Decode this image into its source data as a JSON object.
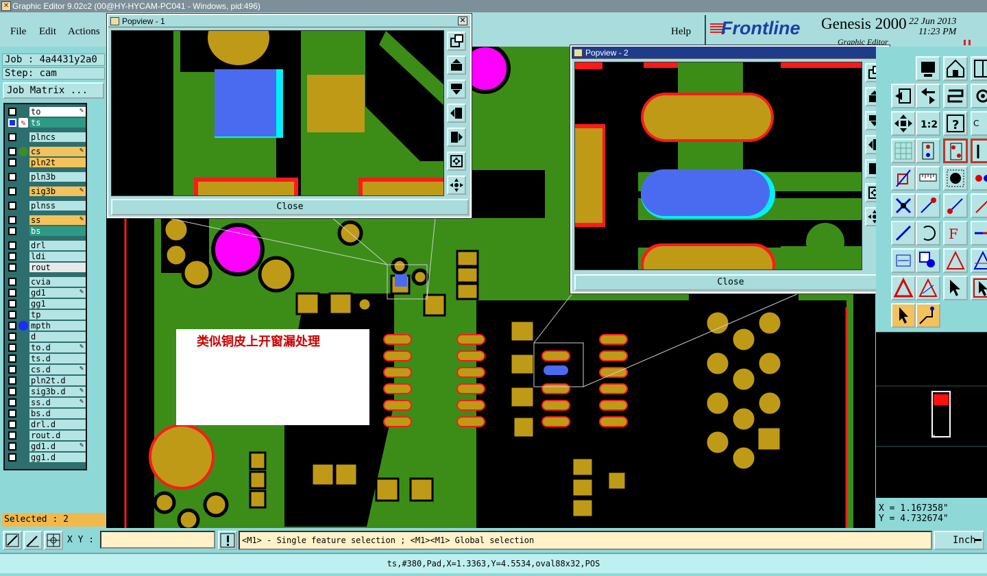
{
  "window": {
    "title": "Graphic Editor 9.02c2 (00@HY-HYCAM-PC041 - Windows, pid:496)"
  },
  "menu": {
    "file": "File",
    "edit": "Edit",
    "actions": "Actions",
    "help": "Help"
  },
  "brand": {
    "logo": "Frontline",
    "product": "Genesis 2000",
    "date": "22 Jun 2013",
    "time": "11:23 PM",
    "subtitle": "Graphic Editor"
  },
  "job": {
    "label": "Job : 4a4431y2a0",
    "step": "Step: cam",
    "matrix_button": "Job Matrix ..."
  },
  "layers": [
    {
      "name": "to",
      "color": "#ffffff",
      "editable": true
    },
    {
      "name": "ts",
      "color": "#2d9a86",
      "editable": false,
      "work": true
    },
    {
      "name": "plncs",
      "color": "#b4e4e4",
      "editable": false
    },
    {
      "name": "cs",
      "color": "#f3c25a",
      "editable": true,
      "dot": "#3a8d2a"
    },
    {
      "name": "pln2t",
      "color": "#f3c25a",
      "editable": false
    },
    {
      "name": "pln3b",
      "color": "#b4e4e4",
      "editable": false
    },
    {
      "name": "sig3b",
      "color": "#f3c25a",
      "editable": true
    },
    {
      "name": "plnss",
      "color": "#b4e4e4",
      "editable": false
    },
    {
      "name": "ss",
      "color": "#f3c25a",
      "editable": true
    },
    {
      "name": "bs",
      "color": "#2d9a86",
      "editable": false
    },
    {
      "name": "drl",
      "color": "#b4e4e4",
      "editable": false
    },
    {
      "name": "ldi",
      "color": "#b4e4e4",
      "editable": false
    },
    {
      "name": "rout",
      "color": "#e8e8e8",
      "editable": false
    },
    {
      "name": "cvia",
      "color": "#b4e4e4",
      "editable": false
    },
    {
      "name": "gd1",
      "color": "#b4e4e4",
      "editable": true
    },
    {
      "name": "gg1",
      "color": "#b4e4e4",
      "editable": false
    },
    {
      "name": "tp",
      "color": "#b4e4e4",
      "editable": false
    },
    {
      "name": "mpth",
      "color": "#b4e4e4",
      "editable": false,
      "dot": "#1b2cff"
    },
    {
      "name": "d",
      "color": "#b4e4e4",
      "editable": false
    },
    {
      "name": "to.d",
      "color": "#b4e4e4",
      "editable": true
    },
    {
      "name": "ts.d",
      "color": "#b4e4e4",
      "editable": false
    },
    {
      "name": "cs.d",
      "color": "#b4e4e4",
      "editable": true
    },
    {
      "name": "pln2t.d",
      "color": "#b4e4e4",
      "editable": false
    },
    {
      "name": "sig3b.d",
      "color": "#b4e4e4",
      "editable": true
    },
    {
      "name": "ss.d",
      "color": "#b4e4e4",
      "editable": true
    },
    {
      "name": "bs.d",
      "color": "#b4e4e4",
      "editable": false
    },
    {
      "name": "drl.d",
      "color": "#b4e4e4",
      "editable": false
    },
    {
      "name": "rout.d",
      "color": "#b4e4e4",
      "editable": false
    },
    {
      "name": "gd1.d",
      "color": "#b4e4e4",
      "editable": true
    },
    {
      "name": "gg1.d",
      "color": "#b4e4e4",
      "editable": false
    }
  ],
  "selection": {
    "label": "Selected : 2"
  },
  "annotation": {
    "text": "类似铜皮上开窗漏处理"
  },
  "popview1": {
    "title": "Popview - 1",
    "close": "Close"
  },
  "popview2": {
    "title": "Popview - 2",
    "close": "Close"
  },
  "coords": {
    "x": "X = 1.167358\"",
    "y": "Y = 4.732674\""
  },
  "bottom": {
    "xy_label": "X Y :",
    "xy_value": "",
    "hint": "<M1> - Single feature selection ; <M1><M1> Global selection",
    "units": "Inch"
  },
  "status": {
    "text": "ts,#380,Pad,X=1.3363,Y=4.5534,oval88x32,POS"
  },
  "colors": {
    "copper": "#3b8d17",
    "pad": "#bf9a16",
    "selected": "#4a6bf0",
    "highlight": "#ff00ff",
    "outline": "#ff1a1a",
    "panel": "#8fd8d8"
  }
}
